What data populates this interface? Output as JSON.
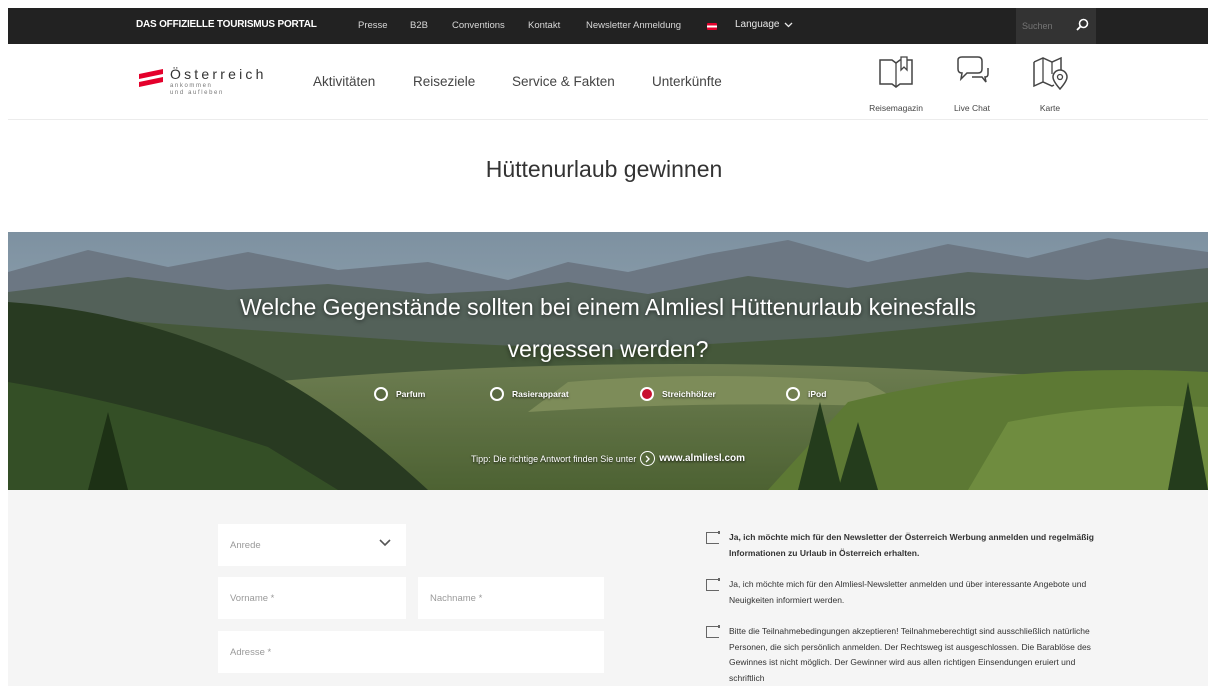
{
  "topbar": {
    "brand": "DAS OFFIZIELLE TOURISMUS PORTAL",
    "links": [
      "Presse",
      "B2B",
      "Conventions",
      "Kontakt",
      "Newsletter Anmeldung"
    ],
    "language_label": "Language",
    "search_placeholder": "Suchen"
  },
  "logo": {
    "name": "Österreich",
    "tagline_1": "ankommen",
    "tagline_2": "und aufleben"
  },
  "nav": {
    "menu": [
      "Aktivitäten",
      "Reiseziele",
      "Service & Fakten",
      "Unterkünfte"
    ],
    "tools": [
      {
        "label": "Reisemagazin",
        "icon": "book-icon"
      },
      {
        "label": "Live Chat",
        "icon": "chat-icon"
      },
      {
        "label": "Karte",
        "icon": "map-icon"
      }
    ]
  },
  "page": {
    "title": "Hüttenurlaub gewinnen"
  },
  "quiz": {
    "question_line_1": "Welche Gegenstände sollten bei einem Almliesl Hüttenurlaub keinesfalls",
    "question_line_2": "vergessen werden?",
    "options": [
      {
        "label": "Parfum",
        "selected": false
      },
      {
        "label": "Rasierapparat",
        "selected": false
      },
      {
        "label": "Streichhölzer",
        "selected": true
      },
      {
        "label": "iPod",
        "selected": false
      }
    ],
    "tip_text": "Tipp: Die richtige Antwort finden Sie unter",
    "tip_url": "www.almliesl.com"
  },
  "form": {
    "salutation_placeholder": "Anrede",
    "firstname_placeholder": "Vorname *",
    "lastname_placeholder": "Nachname *",
    "address_placeholder": "Adresse *"
  },
  "consents": [
    {
      "text": "Ja, ich möchte mich für den Newsletter der Österreich Werbung anmelden und regelmäßig Informationen zu Urlaub in Österreich erhalten.",
      "bold": true
    },
    {
      "text": "Ja, ich möchte mich für den Almliesl-Newsletter anmelden und über interessante Angebote und Neuigkeiten informiert werden.",
      "bold": false
    },
    {
      "text": "Bitte die Teilnahmebedingungen akzeptieren! Teilnahmeberechtigt sind ausschließlich natürliche Personen, die sich persönlich anmelden. Der Rechtsweg ist ausgeschlossen. Die Barablöse des Gewinnes ist nicht möglich. Der Gewinner wird aus allen richtigen Einsendungen eruiert und schriftlich",
      "bold": false
    }
  ],
  "colors": {
    "topbar_bg": "#222222",
    "accent_red": "#c8102e",
    "form_bg": "#f5f5f5"
  }
}
